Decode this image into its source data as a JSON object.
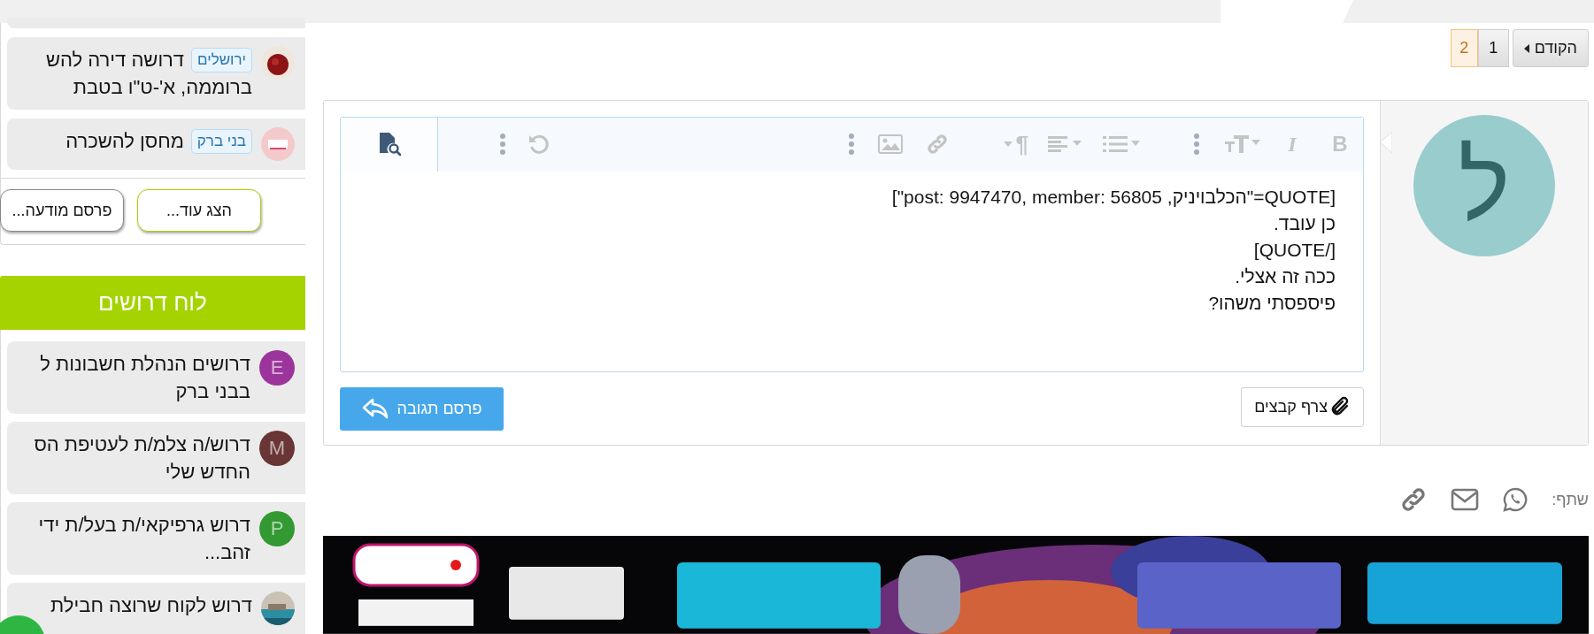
{
  "sidebar": {
    "top_list": [
      {
        "avatar": {
          "kind": "picture"
        },
        "tag": "ירושלים",
        "lines": [
          "דרושה דירה להש",
          "ברוממה, א'-ט\"ו בטבת"
        ]
      },
      {
        "avatar": {
          "kind": "picture"
        },
        "tag": "בני ברק",
        "lines": [
          "מחסן להשכרה"
        ]
      }
    ],
    "buttons": [
      "הצג עוד...",
      "פרסם מודעה..."
    ],
    "board": {
      "title": "לוח דרושים",
      "items": [
        {
          "avatar": {
            "kind": "letter",
            "letter": "E",
            "color": "#9b359b"
          },
          "lines": [
            "דרושים הנהלת חשבונות ל",
            "בבני ברק"
          ]
        },
        {
          "avatar": {
            "kind": "letter",
            "letter": "M",
            "color": "#693535"
          },
          "lines": [
            "דרוש/ה צלמ/ת לעטיפת הס",
            "החדש שלי"
          ]
        },
        {
          "avatar": {
            "kind": "letter",
            "letter": "P",
            "color": "#339933"
          },
          "lines": [
            "דרוש גרפיקאי/ת בעל/ת ידי",
            "זהב..."
          ]
        },
        {
          "avatar": {
            "kind": "picture"
          },
          "lines": [
            "דרוש לקוח שרוצה חבילת"
          ]
        }
      ]
    }
  },
  "pagination": {
    "previous": "הקודם",
    "pages": [
      {
        "label": "1",
        "selected": false
      },
      {
        "label": "2",
        "selected": true
      }
    ]
  },
  "post": {
    "avatar_letter": "ל",
    "toolbar": {
      "bold": "B",
      "italic": "I",
      "paragraph": "¶"
    },
    "editor_lines": [
      "[QUOTE=\"הכלבויניק, post: 9947470, member: 56805\"]",
      "כן עובד.",
      "[/QUOTE]",
      "ככה זה אצלי.",
      "פיספסתי משהו?"
    ],
    "attach_button": "צרף קבצים",
    "submit_button": "פרסם תגובה"
  },
  "share": {
    "label": "שתף:"
  }
}
